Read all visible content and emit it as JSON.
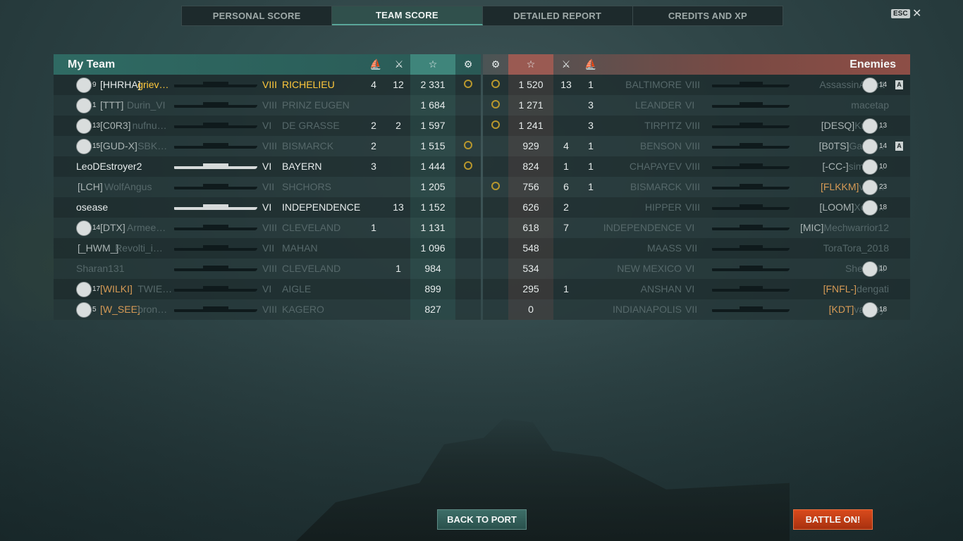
{
  "tabs": [
    "PERSONAL SCORE",
    "TEAM SCORE",
    "DETAILED REPORT",
    "CREDITS AND XP"
  ],
  "active_tab": "TEAM SCORE",
  "esc_label": "ESC",
  "close_glyph": "✕",
  "my_team": {
    "title": "My Team",
    "columns": [
      "torpedo-icon",
      "crossed-swords-icon",
      "star-icon",
      "medal-icon"
    ],
    "rows": [
      {
        "rank": "9",
        "clan": "[HHRHA]",
        "name": "griev…",
        "tier": "VIII",
        "ship": "RICHELIEU",
        "torp": "4",
        "kills": "12",
        "score": "2 331",
        "medal": true,
        "style": "gold"
      },
      {
        "rank": "1",
        "clan": "[TTT]",
        "name": "Durin_VI",
        "tier": "VIII",
        "ship": "PRINZ EUGEN",
        "torp": "",
        "kills": "",
        "score": "1 684",
        "medal": false,
        "style": "dim"
      },
      {
        "rank": "13",
        "clan": "[C0R3]",
        "name": "nufnu…",
        "tier": "VI",
        "ship": "DE GRASSE",
        "torp": "2",
        "kills": "2",
        "score": "1 597",
        "medal": false,
        "style": "dim"
      },
      {
        "rank": "15",
        "clan": "[GUD-X]",
        "name": "SBK…",
        "tier": "VIII",
        "ship": "BISMARCK",
        "torp": "2",
        "kills": "",
        "score": "1 515",
        "medal": true,
        "style": "dim"
      },
      {
        "rank": "",
        "clan": "",
        "name": "LeoDEstroyer2",
        "tier": "VI",
        "ship": "BAYERN",
        "torp": "3",
        "kills": "",
        "score": "1 444",
        "medal": true,
        "style": "lit"
      },
      {
        "rank": "",
        "clan": "[LCH]",
        "name": "WolfAngus",
        "tier": "VII",
        "ship": "SHCHORS",
        "torp": "",
        "kills": "",
        "score": "1 205",
        "medal": false,
        "style": "dim"
      },
      {
        "rank": "",
        "clan": "",
        "name": "osease",
        "tier": "VI",
        "ship": "INDEPENDENCE",
        "torp": "",
        "kills": "13",
        "score": "1 152",
        "medal": false,
        "style": "lit"
      },
      {
        "rank": "14",
        "clan": "[DTX]",
        "name": "Armee…",
        "tier": "VIII",
        "ship": "CLEVELAND",
        "torp": "1",
        "kills": "",
        "score": "1 131",
        "medal": false,
        "style": "dim"
      },
      {
        "rank": "",
        "clan": "[_HWM_]",
        "name": "Revolti_i…",
        "tier": "VII",
        "ship": "MAHAN",
        "torp": "",
        "kills": "",
        "score": "1 096",
        "medal": false,
        "style": "dim"
      },
      {
        "rank": "",
        "clan": "",
        "name": "Sharan131",
        "tier": "VIII",
        "ship": "CLEVELAND",
        "torp": "",
        "kills": "1",
        "score": "984",
        "medal": false,
        "style": "dim"
      },
      {
        "rank": "17",
        "clan": "[WILKI]",
        "name": "TWIE…",
        "tier": "VI",
        "ship": "AIGLE",
        "torp": "",
        "kills": "",
        "score": "899",
        "medal": false,
        "style": "dim-orange"
      },
      {
        "rank": "5",
        "clan": "[W_SEE]",
        "name": "bron…",
        "tier": "VIII",
        "ship": "KAGERO",
        "torp": "",
        "kills": "",
        "score": "827",
        "medal": false,
        "style": "dim-orange"
      }
    ]
  },
  "enemies": {
    "title": "Enemies",
    "columns": [
      "medal-icon",
      "star-icon",
      "crossed-swords-icon",
      "torpedo-icon"
    ],
    "rows": [
      {
        "medal": true,
        "score": "1 520",
        "kills": "13",
        "torp": "1",
        "ship": "BALTIMORE",
        "tier": "VIII",
        "clan": "",
        "name": "AssassinAgent",
        "rank": "14",
        "badge": "A"
      },
      {
        "medal": true,
        "score": "1 271",
        "kills": "",
        "torp": "3",
        "ship": "LEANDER",
        "tier": "VI",
        "clan": "",
        "name": "macetap",
        "rank": "",
        "badge": ""
      },
      {
        "medal": true,
        "score": "1 241",
        "kills": "",
        "torp": "3",
        "ship": "TIRPITZ",
        "tier": "VIII",
        "clan": "[DESQ]",
        "name": "Krak…",
        "rank": "13",
        "badge": ""
      },
      {
        "medal": false,
        "score": "929",
        "kills": "4",
        "torp": "1",
        "ship": "BENSON",
        "tier": "VIII",
        "clan": "[B0TS]",
        "name": "Gallifr…",
        "rank": "14",
        "badge": "A"
      },
      {
        "medal": false,
        "score": "824",
        "kills": "1",
        "torp": "1",
        "ship": "CHAPAYEV",
        "tier": "VIII",
        "clan": "[-CC-]",
        "name": "simba…",
        "rank": "10",
        "badge": ""
      },
      {
        "medal": true,
        "score": "756",
        "kills": "6",
        "torp": "1",
        "ship": "BISMARCK",
        "tier": "VIII",
        "clan": "[FLKKM]",
        "name": "vari…",
        "rank": "23",
        "badge": ""
      },
      {
        "medal": false,
        "score": "626",
        "kills": "2",
        "torp": "",
        "ship": "HIPPER",
        "tier": "VIII",
        "clan": "[LOOM]",
        "name": "Xord…",
        "rank": "18",
        "badge": ""
      },
      {
        "medal": false,
        "score": "618",
        "kills": "7",
        "torp": "",
        "ship": "INDEPENDENCE",
        "tier": "VI",
        "clan": "[MIC]",
        "name": "Mechwarrior12",
        "rank": "",
        "badge": ""
      },
      {
        "medal": false,
        "score": "548",
        "kills": "",
        "torp": "",
        "ship": "MAASS",
        "tier": "VII",
        "clan": "",
        "name": "ToraTora_2018",
        "rank": "",
        "badge": ""
      },
      {
        "medal": false,
        "score": "534",
        "kills": "",
        "torp": "",
        "ship": "NEW MEXICO",
        "tier": "VI",
        "clan": "",
        "name": "Shellbelli",
        "rank": "10",
        "badge": ""
      },
      {
        "medal": false,
        "score": "295",
        "kills": "1",
        "torp": "",
        "ship": "ANSHAN",
        "tier": "VI",
        "clan": "[FNFL-]",
        "name": "dengati",
        "rank": "",
        "badge": ""
      },
      {
        "medal": false,
        "score": "0",
        "kills": "",
        "torp": "",
        "ship": "INDIANAPOLIS",
        "tier": "VII",
        "clan": "[KDT]",
        "name": "vassey",
        "rank": "18",
        "badge": ""
      }
    ]
  },
  "buttons": {
    "back": "BACK TO PORT",
    "battle": "BATTLE ON!"
  },
  "colors": {
    "accent": "#3f857b",
    "enemy": "#9a5a52",
    "highlight": "#ffc83c",
    "battle": "#c83c14"
  }
}
